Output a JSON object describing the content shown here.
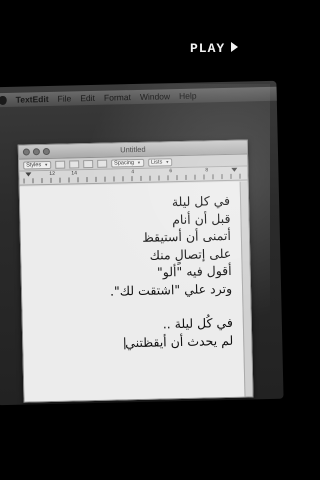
{
  "overlay": {
    "label": "PLAY",
    "icon": "play-triangle-icon"
  },
  "menubar": {
    "app": "TextEdit",
    "items": [
      "File",
      "Edit",
      "Format",
      "Window",
      "Help"
    ]
  },
  "window": {
    "title": "Untitled",
    "toolbar": {
      "style": "Styles",
      "spacing": "Spacing",
      "lists": "Lists"
    },
    "ruler": [
      "12",
      "14",
      "4",
      "6",
      "8"
    ]
  },
  "document": {
    "lines": [
      "في كل ليلة",
      "قبل أن أنام",
      "أتمنى أن أستيقظ",
      "على إتصالٍ منك",
      "أقول فيه \"ألو\"",
      "وترد علي \"اشتقت لك\"."
    ],
    "lines2": [
      "في كُل ليلة ..",
      "لم يحدث أن أيقظتني"
    ]
  }
}
